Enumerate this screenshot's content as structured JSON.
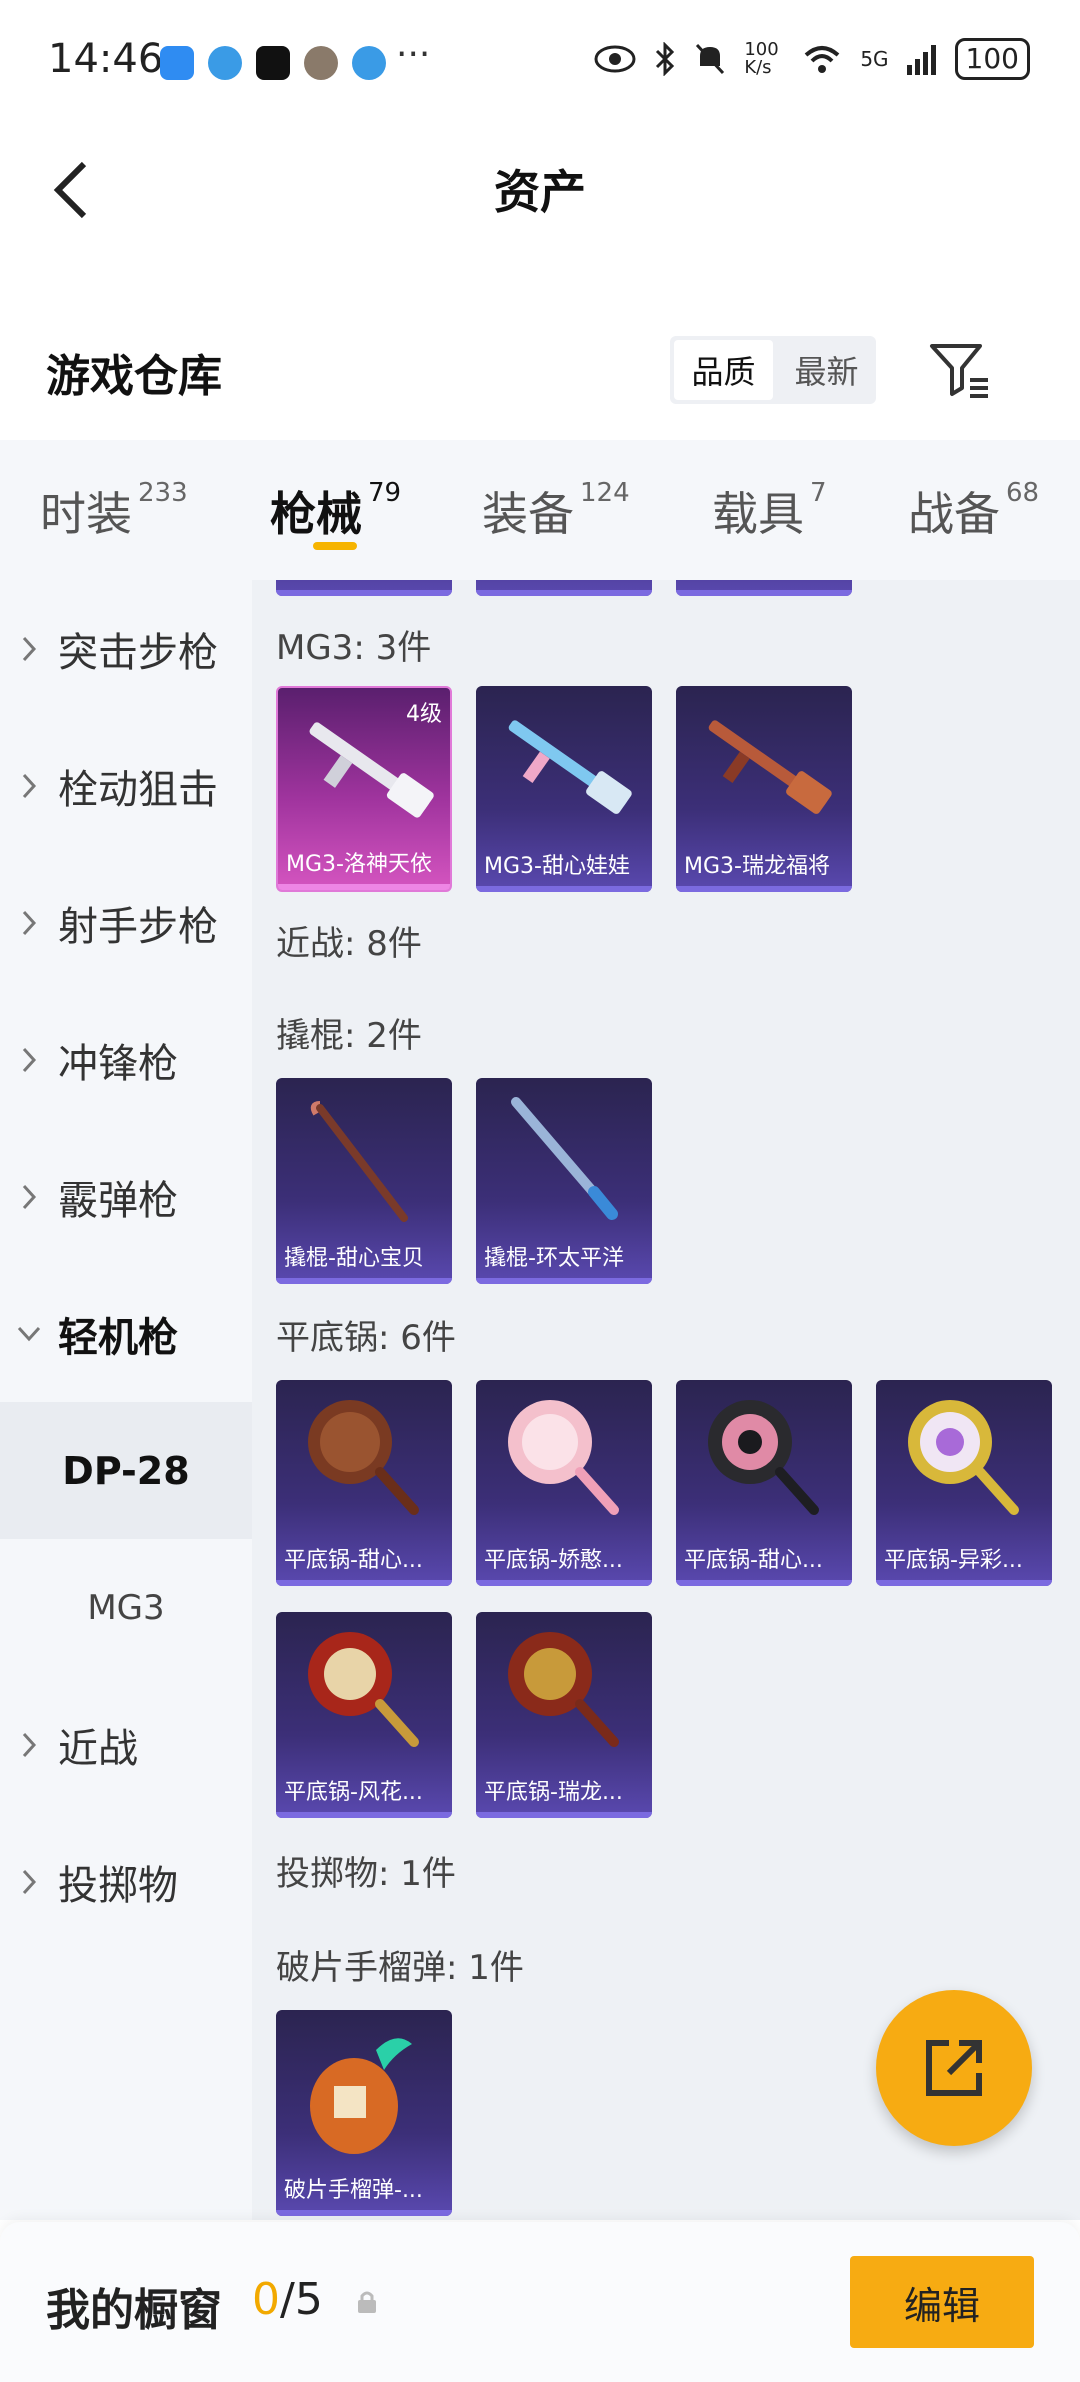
{
  "status_bar": {
    "time": "14:46",
    "more": "···",
    "net_speed": "100 K/s",
    "signal": "5G",
    "battery": "100"
  },
  "header": {
    "title": "资产"
  },
  "warehouse": {
    "title": "游戏仓库",
    "sort_options": [
      "品质",
      "最新"
    ]
  },
  "tabs": [
    {
      "label": "时装",
      "count": "233"
    },
    {
      "label": "枪械",
      "count": "79"
    },
    {
      "label": "装备",
      "count": "124"
    },
    {
      "label": "载具",
      "count": "7"
    },
    {
      "label": "战备",
      "count": "68"
    }
  ],
  "sidebar": {
    "items": [
      {
        "label": "突击步枪"
      },
      {
        "label": "栓动狙击"
      },
      {
        "label": "射手步枪"
      },
      {
        "label": "冲锋枪"
      },
      {
        "label": "霰弹枪"
      },
      {
        "label": "轻机枪"
      },
      {
        "label": "近战"
      },
      {
        "label": "投掷物"
      }
    ],
    "sub_items": [
      {
        "label": "DP-28"
      },
      {
        "label": "MG3"
      }
    ]
  },
  "content": {
    "groups": [
      {
        "label": "MG3: 3件",
        "cards": [
          {
            "name": "MG3-洛神天依",
            "level": "4级"
          },
          {
            "name": "MG3-甜心娃娃"
          },
          {
            "name": "MG3-瑞龙福将"
          }
        ]
      },
      {
        "label": "近战: 8件"
      },
      {
        "label": "撬棍: 2件",
        "cards": [
          {
            "name": "撬棍-甜心宝贝"
          },
          {
            "name": "撬棍-环太平洋"
          }
        ]
      },
      {
        "label": "平底锅: 6件",
        "cards": [
          {
            "name": "平底锅-甜心..."
          },
          {
            "name": "平底锅-娇憨..."
          },
          {
            "name": "平底锅-甜心..."
          },
          {
            "name": "平底锅-异彩..."
          },
          {
            "name": "平底锅-风花..."
          },
          {
            "name": "平底锅-瑞龙..."
          }
        ]
      },
      {
        "label": "投掷物: 1件"
      },
      {
        "label": "破片手榴弹: 1件",
        "cards": [
          {
            "name": "破片手榴弹-..."
          }
        ]
      }
    ]
  },
  "showcase": {
    "label": "我的橱窗",
    "used": "0",
    "total": "/5",
    "edit_label": "编辑"
  }
}
